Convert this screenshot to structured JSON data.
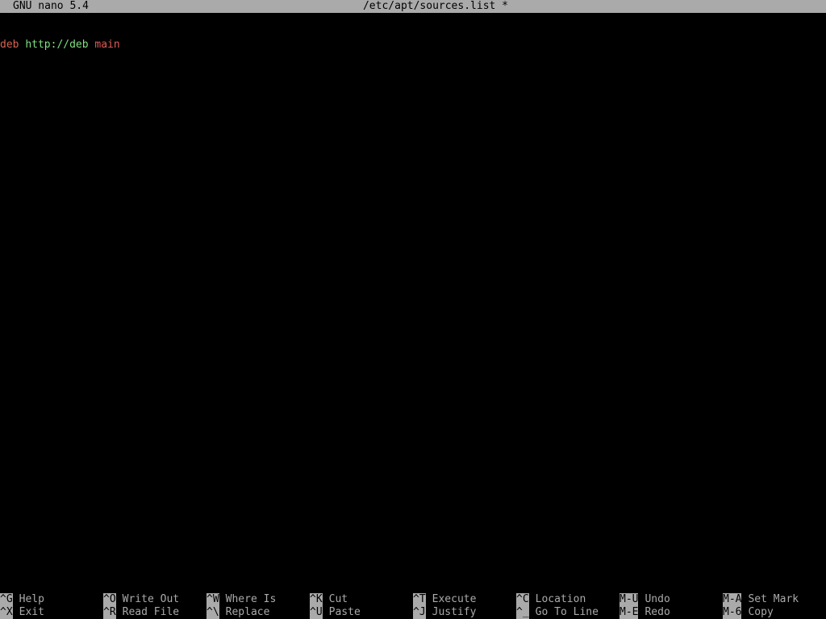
{
  "titlebar": {
    "app": "GNU nano 5.4",
    "filename": "/etc/apt/sources.list *"
  },
  "editor": {
    "line1": {
      "kw": "deb",
      "url": "http://deb",
      "component": "main"
    }
  },
  "shortcuts": {
    "row1": [
      {
        "key": "^G",
        "label": "Help"
      },
      {
        "key": "^O",
        "label": "Write Out"
      },
      {
        "key": "^W",
        "label": "Where Is"
      },
      {
        "key": "^K",
        "label": "Cut"
      },
      {
        "key": "^T",
        "label": "Execute"
      },
      {
        "key": "^C",
        "label": "Location"
      },
      {
        "key": "M-U",
        "label": "Undo"
      },
      {
        "key": "M-A",
        "label": "Set Mark"
      }
    ],
    "row2": [
      {
        "key": "^X",
        "label": "Exit"
      },
      {
        "key": "^R",
        "label": "Read File"
      },
      {
        "key": "^\\",
        "label": "Replace"
      },
      {
        "key": "^U",
        "label": "Paste"
      },
      {
        "key": "^J",
        "label": "Justify"
      },
      {
        "key": "^_",
        "label": "Go To Line"
      },
      {
        "key": "M-E",
        "label": "Redo"
      },
      {
        "key": "M-6",
        "label": "Copy"
      }
    ]
  },
  "colors": {
    "background": "#000000",
    "bar": "#aaaaaa",
    "keyword": "#d8634f",
    "url": "#7fe07f",
    "component": "#e05a5a"
  }
}
